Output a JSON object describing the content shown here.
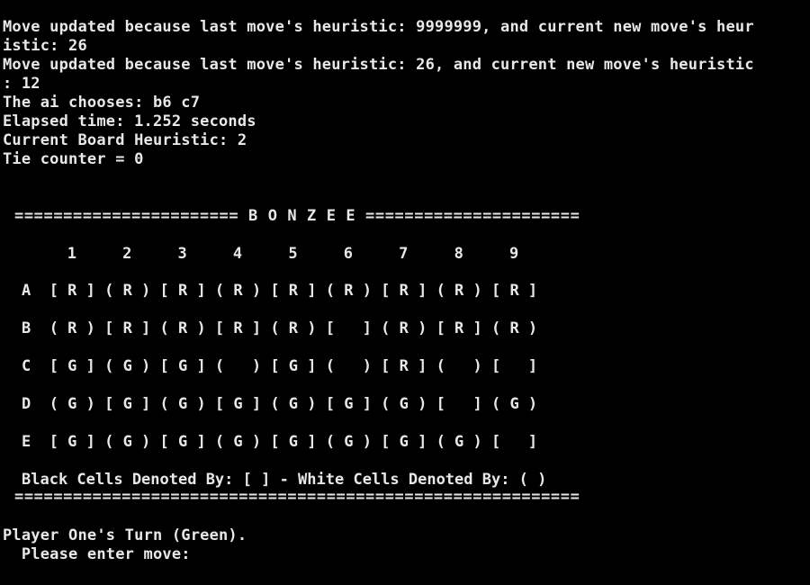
{
  "log": {
    "line1": "Move updated because last move's heuristic: 9999999, and current new move's heur",
    "line2": "istic: 26",
    "line3": "Move updated because last move's heuristic: 26, and current new move's heuristic",
    "line4": ": 12",
    "line5": "The ai chooses: b6 c7",
    "line6": "Elapsed time: 1.252 seconds",
    "line7": "Current Board Heuristic: 2",
    "line8": "Tie counter = 0"
  },
  "board": {
    "title_rule": "======================= B O N Z E E ======================",
    "columns": "   1     2     3     4     5     6     7     8     9",
    "rows": [
      "A  [ R ] ( R ) [ R ] ( R ) [ R ] ( R ) [ R ] ( R ) [ R ]",
      "B  ( R ) [ R ] ( R ) [ R ] ( R ) [   ] ( R ) [ R ] ( R )",
      "C  [ G ] ( G ) [ G ] (   ) [ G ] (   ) [ R ] (   ) [   ]",
      "D  ( G ) [ G ] ( G ) [ G ] ( G ) [ G ] ( G ) [   ] ( G )",
      "E  [ G ] ( G ) [ G ] ( G ) [ G ] ( G ) [ G ] ( G ) [   ]"
    ],
    "legend": "Black Cells Denoted By: [ ] - White Cells Denoted By: ( )",
    "bottom_rule": "=========================================================="
  },
  "prompt": {
    "turn": "Player One's Turn (Green).",
    "enter": "  Please enter move:"
  }
}
